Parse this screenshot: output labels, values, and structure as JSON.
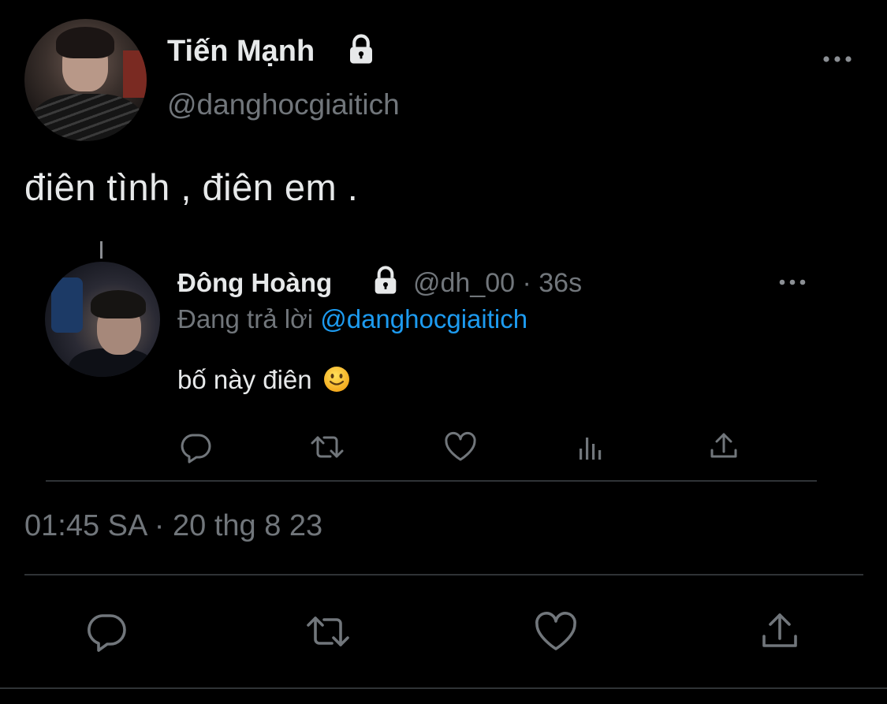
{
  "tweet": {
    "display_name": "Tiến Mạnh",
    "handle": "@danghocgiaitich",
    "text": "điên tình , điên em .",
    "timestamp": "01:45 SA · 20 thg 8 23",
    "lock_icon": "lock-icon",
    "more_icon": "more-horizontal-icon"
  },
  "reply": {
    "display_name": "Đông Hoàng",
    "meta": "@dh_00 · 36s",
    "replying_label": "Đang trả lời",
    "replying_to": "@danghocgiaitich",
    "text": "bố này điên",
    "emoji": "slightly-smiling-face"
  },
  "reply_actions": [
    "comment-icon",
    "retweet-icon",
    "like-icon",
    "views-icon",
    "share-icon"
  ],
  "main_actions": [
    "comment-icon",
    "retweet-icon",
    "like-icon",
    "share-icon"
  ],
  "colors": {
    "background": "#000000",
    "primary_text": "#e7e9ea",
    "secondary_text": "#71767b",
    "link": "#1d9bf0",
    "divider": "#2f3336"
  }
}
